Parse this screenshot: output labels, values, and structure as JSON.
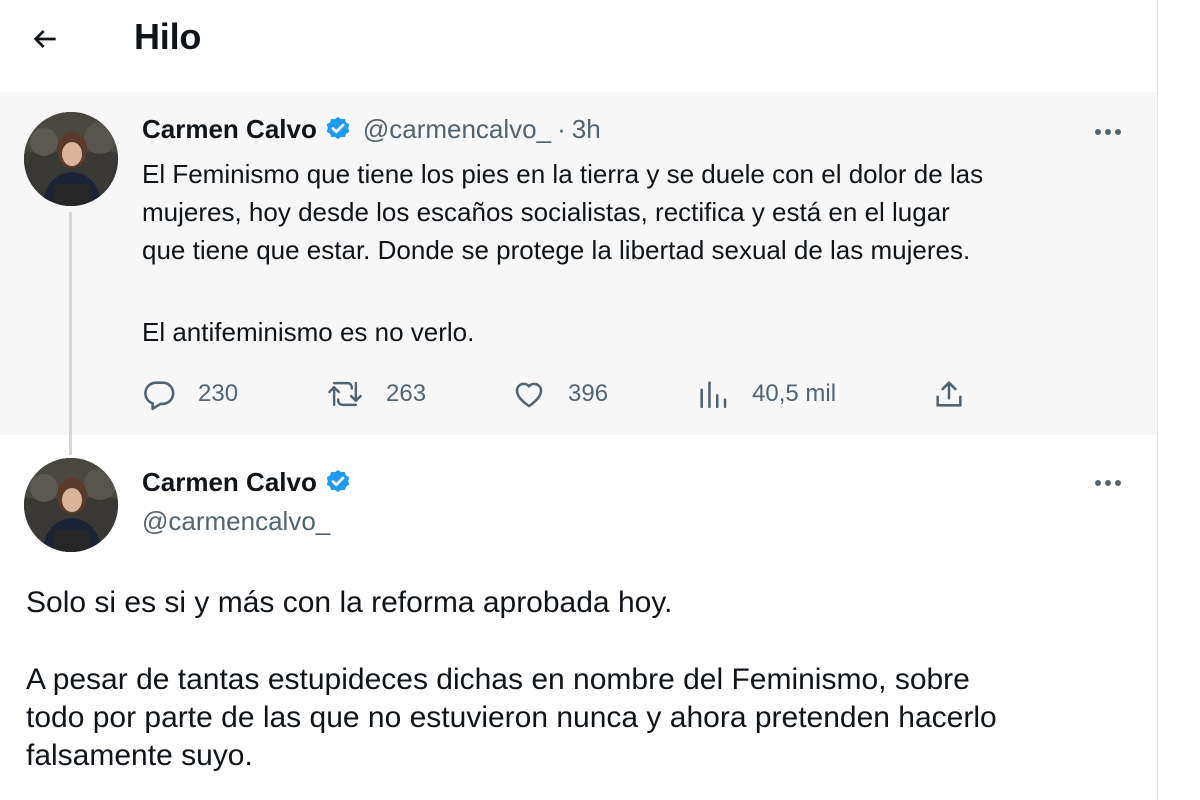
{
  "header": {
    "title": "Hilo",
    "back_icon": "arrow-left-icon"
  },
  "colors": {
    "verified_blue": "#1d9bf0",
    "muted_text": "#536471",
    "thread_bg": "#f7f7f7"
  },
  "tweet1": {
    "author_name": "Carmen Calvo",
    "handle": "@carmencalvo_",
    "separator": "·",
    "time": "3h",
    "text": "El Feminismo que tiene los pies en la tierra y se duele con el dolor de las\nmujeres, hoy desde los escaños socialistas, rectifica y está en el lugar\nque tiene que estar. Donde se protege la libertad sexual de las mujeres.",
    "text2": "El antifeminismo es no verlo.",
    "stats": {
      "replies": "230",
      "retweets": "263",
      "likes": "396",
      "views": "40,5 mil"
    }
  },
  "tweet2": {
    "author_name": "Carmen Calvo",
    "handle": "@carmencalvo_",
    "text": "Solo si es si y más con la reforma aprobada hoy.",
    "text2": "A pesar de tantas estupideces dichas en nombre del Feminismo, sobre\ntodo por parte de las que no estuvieron nunca y ahora pretenden hacerlo\nfalsamente suyo."
  }
}
